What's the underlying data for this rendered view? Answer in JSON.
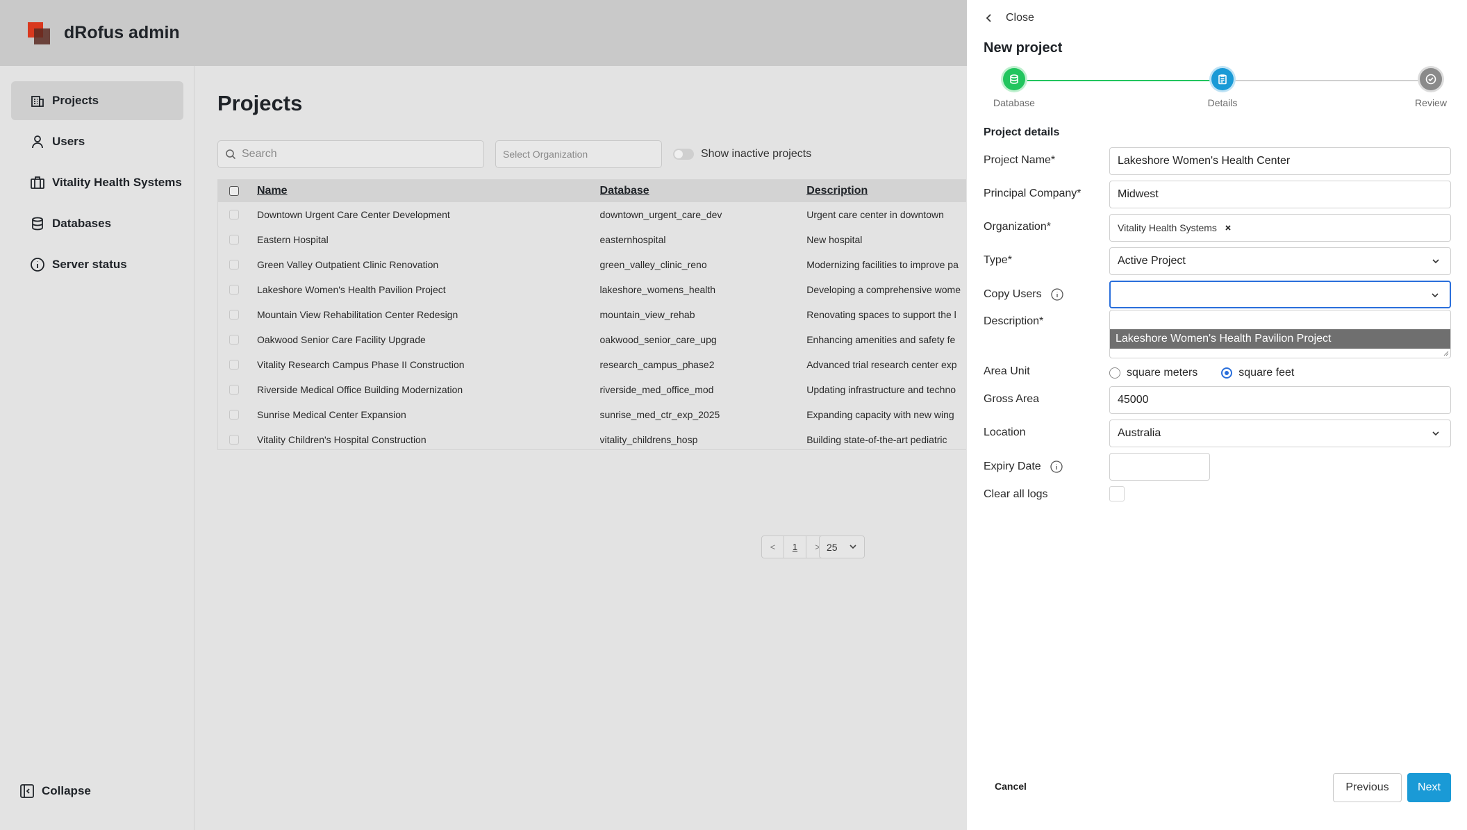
{
  "app": {
    "title": "dRofus admin"
  },
  "sidebar": {
    "items": [
      {
        "label": "Projects",
        "icon": "building-icon"
      },
      {
        "label": "Users",
        "icon": "user-icon"
      },
      {
        "label": "Vitality Health Systems",
        "icon": "briefcase-icon"
      },
      {
        "label": "Databases",
        "icon": "database-icon"
      },
      {
        "label": "Server status",
        "icon": "info-icon"
      }
    ],
    "collapse_label": "Collapse"
  },
  "main": {
    "title": "Projects",
    "search_placeholder": "Search",
    "org_placeholder": "Select Organization",
    "inactive_toggle_label": "Show inactive projects",
    "table": {
      "columns": [
        "Name",
        "Database",
        "Description"
      ],
      "rows": [
        {
          "name": "Downtown Urgent Care Center Development",
          "database": "downtown_urgent_care_dev",
          "description": "Urgent care center in downtown"
        },
        {
          "name": "Eastern Hospital",
          "database": "easternhospital",
          "description": "New hospital"
        },
        {
          "name": "Green Valley Outpatient Clinic Renovation",
          "database": "green_valley_clinic_reno",
          "description": "Modernizing facilities to improve pa"
        },
        {
          "name": "Lakeshore Women's Health Pavilion Project",
          "database": "lakeshore_womens_health",
          "description": "Developing a comprehensive wome"
        },
        {
          "name": "Mountain View Rehabilitation Center Redesign",
          "database": "mountain_view_rehab",
          "description": "Renovating spaces to support the l"
        },
        {
          "name": "Oakwood Senior Care Facility Upgrade",
          "database": "oakwood_senior_care_upg",
          "description": "Enhancing amenities and safety fe"
        },
        {
          "name": "Vitality Research Campus Phase II Construction",
          "database": "research_campus_phase2",
          "description": "Advanced trial research center exp"
        },
        {
          "name": "Riverside Medical Office Building Modernization",
          "database": "riverside_med_office_mod",
          "description": "Updating infrastructure and techno"
        },
        {
          "name": "Sunrise Medical Center Expansion",
          "database": "sunrise_med_ctr_exp_2025",
          "description": "Expanding capacity with new wing"
        },
        {
          "name": "Vitality Children's Hospital Construction",
          "database": "vitality_childrens_hosp",
          "description": "Building state-of-the-art pediatric"
        }
      ]
    },
    "pagination": {
      "prev": "<",
      "current": "1",
      "next": ">",
      "page_size": "25"
    }
  },
  "drawer": {
    "close_label": "Close",
    "title": "New project",
    "steps": [
      {
        "label": "Database",
        "state": "complete"
      },
      {
        "label": "Details",
        "state": "current"
      },
      {
        "label": "Review",
        "state": "pending"
      }
    ],
    "section_title": "Project details",
    "fields": {
      "project_name": {
        "label": "Project Name*",
        "value": "Lakeshore Women's Health Center"
      },
      "principal_company": {
        "label": "Principal Company*",
        "value": "Midwest"
      },
      "organization": {
        "label": "Organization*",
        "tag": "Vitality Health Systems"
      },
      "type": {
        "label": "Type*",
        "value": "Active Project"
      },
      "copy_users": {
        "label": "Copy Users",
        "value": "",
        "dropdown_option": "Lakeshore Women's Health Pavilion Project"
      },
      "description": {
        "label": "Description*"
      },
      "area_unit": {
        "label": "Area Unit",
        "options": [
          "square meters",
          "square feet"
        ],
        "selected": "square feet"
      },
      "gross_area": {
        "label": "Gross Area",
        "value": "45000"
      },
      "location": {
        "label": "Location",
        "value": "Australia"
      },
      "expiry_date": {
        "label": "Expiry Date",
        "value": ""
      },
      "clear_logs": {
        "label": "Clear all logs",
        "checked": false
      }
    },
    "buttons": {
      "cancel": "Cancel",
      "previous": "Previous",
      "next": "Next"
    }
  },
  "colors": {
    "accent": "#1a9ad6",
    "step_complete": "#22c55e",
    "focus": "#2a6fdb",
    "brand_red": "#d9381e"
  }
}
